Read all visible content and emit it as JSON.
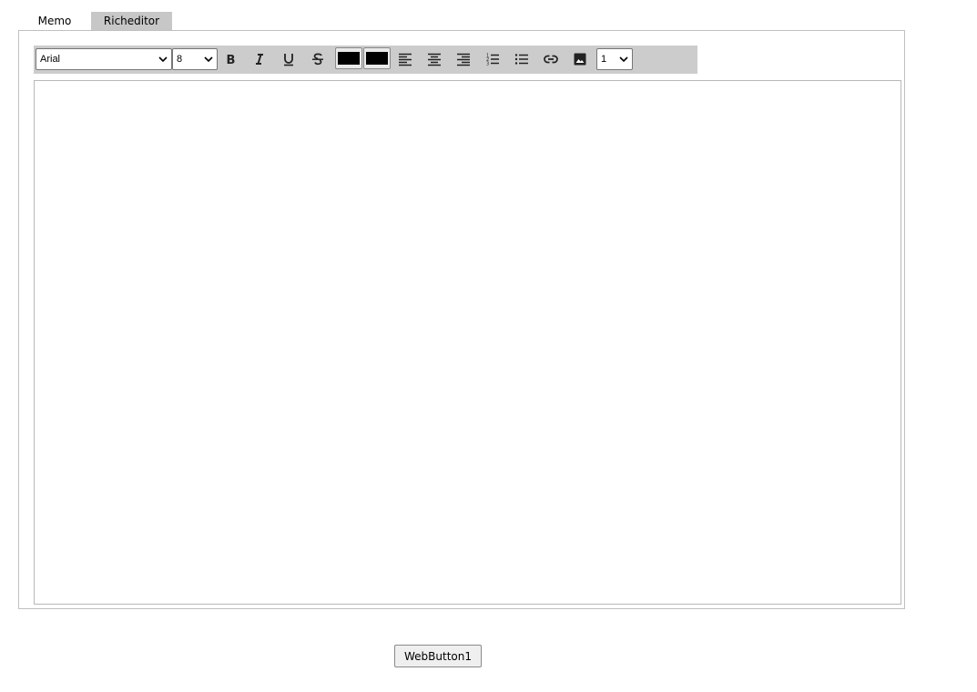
{
  "tabs": [
    {
      "label": "Memo",
      "selected": false
    },
    {
      "label": "Richeditor",
      "selected": true
    }
  ],
  "toolbar": {
    "font_family": "Arial",
    "font_size": "8",
    "heading_level": "1",
    "buttons": [
      "bold-icon",
      "italic-icon",
      "underline-icon",
      "strikethrough-icon",
      "align-left-icon",
      "align-center-icon",
      "align-right-icon",
      "ordered-list-icon",
      "unordered-list-icon",
      "link-icon",
      "image-icon"
    ],
    "text_color": "#000000",
    "background_color": "#000000"
  },
  "editor": {
    "content": ""
  },
  "button": {
    "label": "WebButton1"
  }
}
